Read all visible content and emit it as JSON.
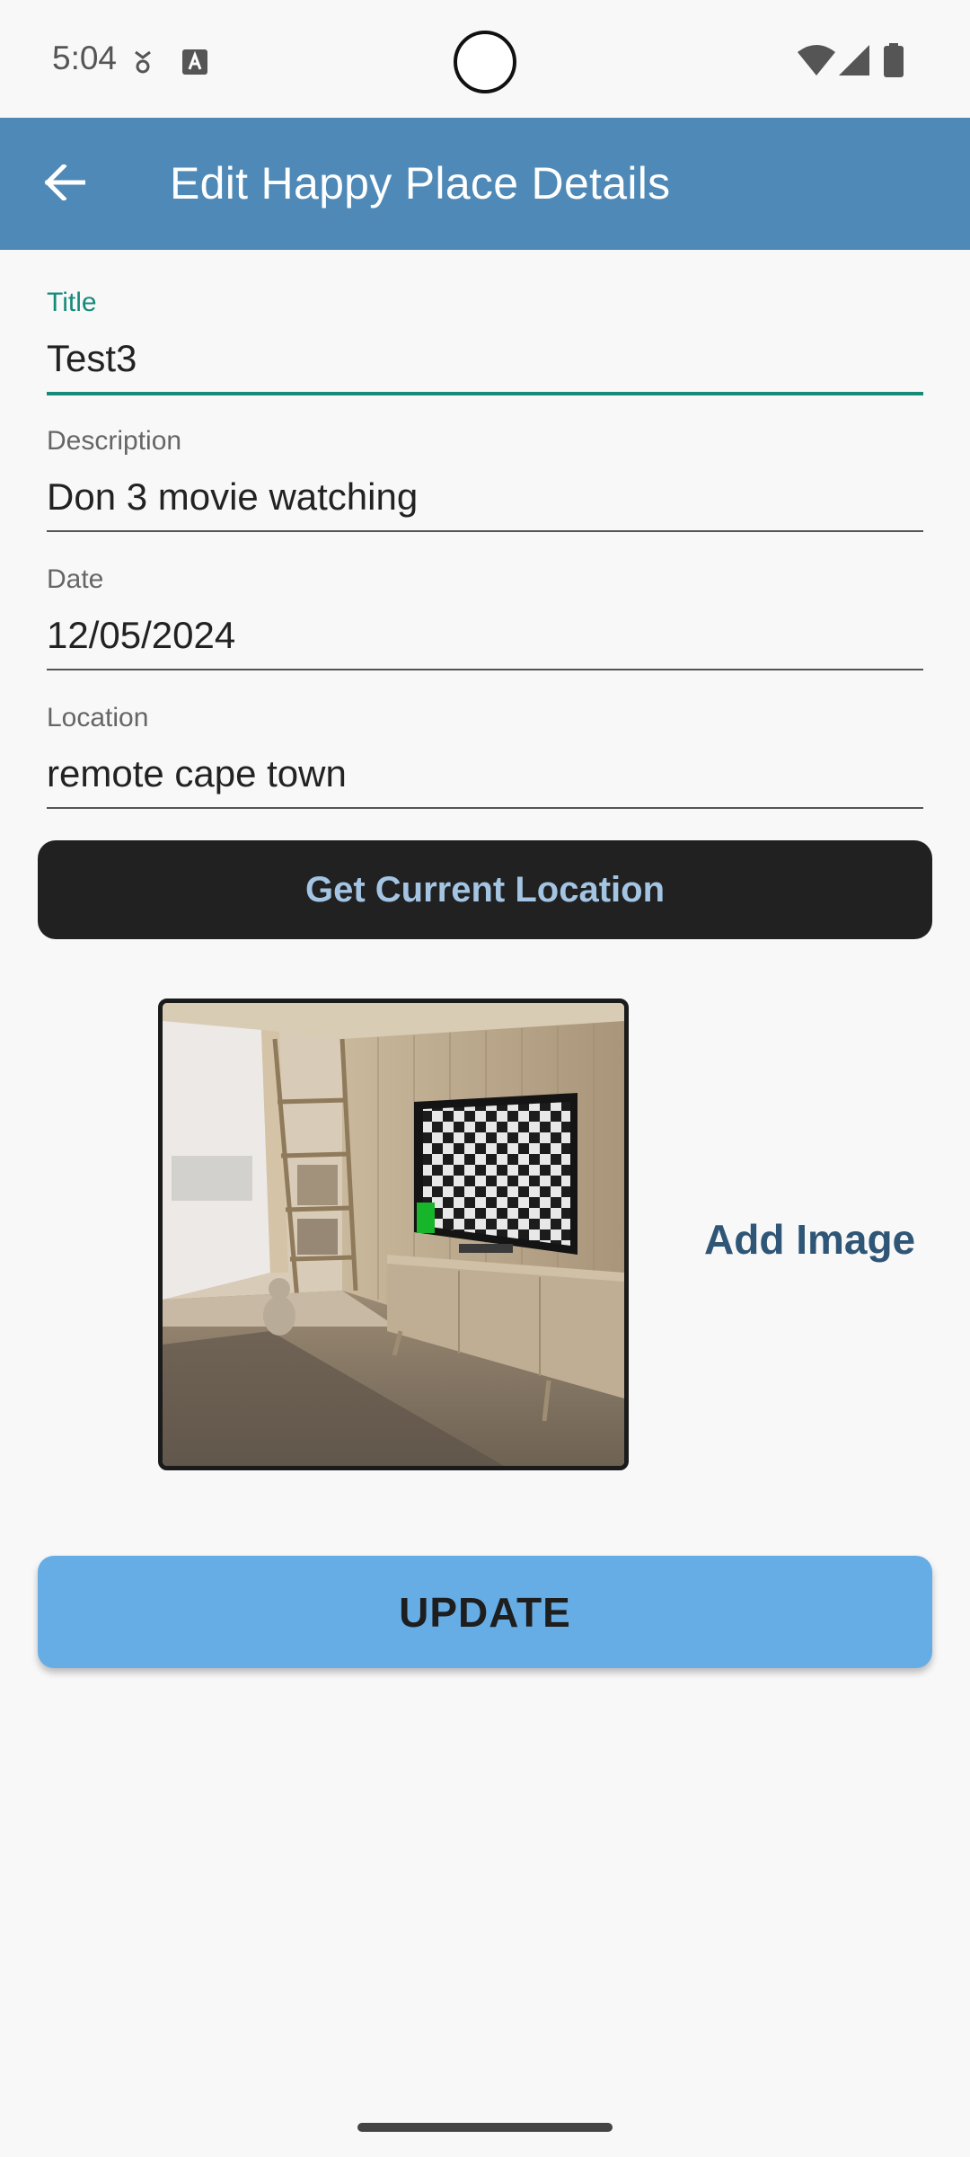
{
  "status_bar": {
    "time": "5:04",
    "icons": [
      "notification-dot-icon",
      "text-a-icon",
      "wifi-icon",
      "cellular-signal-icon",
      "battery-icon"
    ]
  },
  "app_bar": {
    "back_icon": "arrow-left-icon",
    "title": "Edit Happy Place Details",
    "color": "#4e89b7"
  },
  "form": {
    "title_field": {
      "label": "Title",
      "value": "Test3"
    },
    "description_field": {
      "label": "Description",
      "value": "Don 3 movie watching"
    },
    "date_field": {
      "label": "Date",
      "value": "12/05/2024"
    },
    "location_field": {
      "label": "Location",
      "value": "remote cape town"
    }
  },
  "get_location_button": {
    "label": "Get Current Location"
  },
  "image": {
    "icon": "room-tv-photo"
  },
  "add_image": {
    "label": "Add Image"
  },
  "update_button": {
    "label": "UPDATE"
  },
  "colors": {
    "accent": "#178a7a",
    "update_button": "#66ade6",
    "location_button": "#212121",
    "add_image_text": "#2f5676"
  }
}
